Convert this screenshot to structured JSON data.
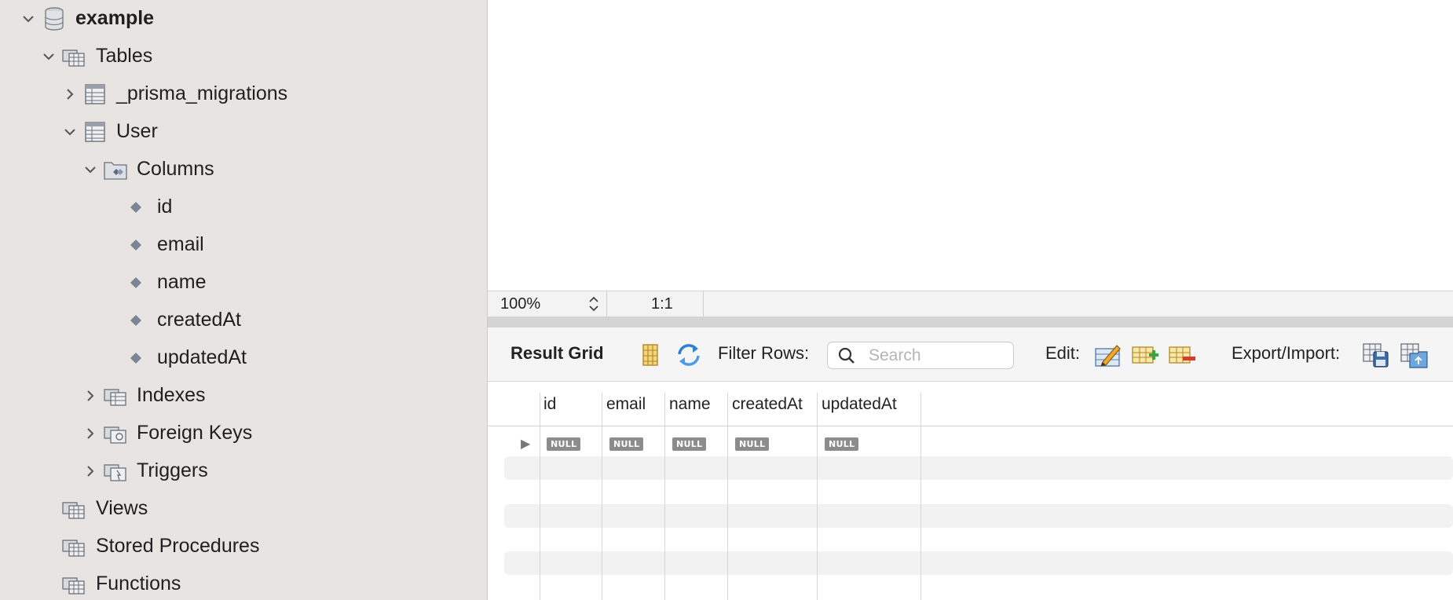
{
  "sidebar": {
    "schema": "example",
    "tables_label": "Tables",
    "tables": [
      {
        "name": "_prisma_migrations"
      },
      {
        "name": "User"
      }
    ],
    "columns_label": "Columns",
    "columns": [
      "id",
      "email",
      "name",
      "createdAt",
      "updatedAt"
    ],
    "indexes_label": "Indexes",
    "foreign_keys_label": "Foreign Keys",
    "triggers_label": "Triggers",
    "views_label": "Views",
    "stored_procedures_label": "Stored Procedures",
    "functions_label": "Functions"
  },
  "status": {
    "zoom": "100%",
    "cursor": "1:1"
  },
  "result": {
    "title": "Result Grid",
    "filter_label": "Filter Rows:",
    "search_placeholder": "Search",
    "edit_label": "Edit:",
    "export_label": "Export/Import:",
    "columns": [
      "id",
      "email",
      "name",
      "createdAt",
      "updatedAt"
    ],
    "row_marker": "▶",
    "null_text": "NULL"
  },
  "colors": {
    "sidebar_bg": "#e8e4e1",
    "toolbar_bg": "#f5f5f5",
    "splitter": "#d4d4d4",
    "null_badge": "#8c8c8c"
  },
  "icons": {
    "schema": "database-icon",
    "folder": "table-folder-icon",
    "table": "table-icon",
    "column": "column-diamond-icon",
    "toggle_grid": "grid-toggle-icon",
    "refresh": "refresh-icon",
    "edit": "edit-pencil-icon",
    "add_row": "add-row-icon",
    "delete_row": "delete-row-icon",
    "export": "export-icon",
    "import": "import-icon"
  }
}
